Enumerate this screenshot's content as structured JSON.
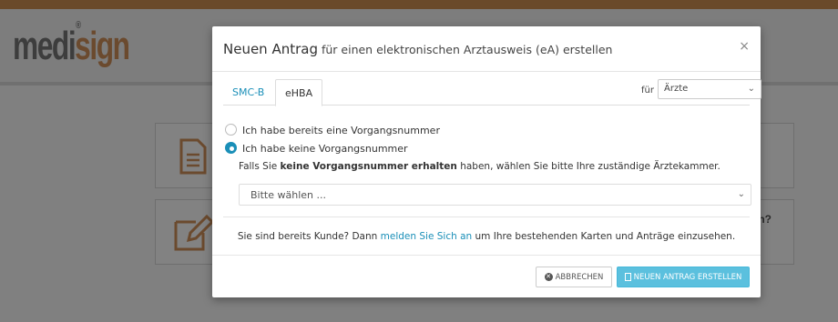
{
  "background": {
    "logo_main": "medi",
    "logo_accent": "sign",
    "logo_reg": "®",
    "card2_text": "n?"
  },
  "modal": {
    "title_strong": "Neuen Antrag",
    "title_sub": " für einen elektronischen Arztausweis (eA) erstellen",
    "close_label": "×",
    "tabs": [
      {
        "label": "SMC-B",
        "active": false
      },
      {
        "label": "eHBA",
        "active": true
      }
    ],
    "fuer_label": "für",
    "fuer_select_value": "Ärzte",
    "radio_options": [
      {
        "label": "Ich habe bereits eine Vorgangsnummer",
        "checked": false
      },
      {
        "label": "Ich habe keine Vorgangsnummer",
        "checked": true
      }
    ],
    "info_prefix": "Falls Sie ",
    "info_bold": "keine Vorgangsnummer erhalten",
    "info_suffix": " haben, wählen Sie bitte Ihre zuständige Ärztekammer.",
    "kammer_select_placeholder": "Bitte wählen ...",
    "kunde_prefix": "Sie sind bereits Kunde? Dann ",
    "kunde_link": "melden Sie Sich an",
    "kunde_suffix": " um Ihre bestehenden Karten und Anträge einzusehen.",
    "cancel_label": "ABBRECHEN",
    "create_label": "NEUEN ANTRAG ERSTELLEN"
  },
  "colors": {
    "accent": "#5bc0de",
    "link": "#1a8fb8",
    "brand_brown": "#6b4a2e"
  }
}
